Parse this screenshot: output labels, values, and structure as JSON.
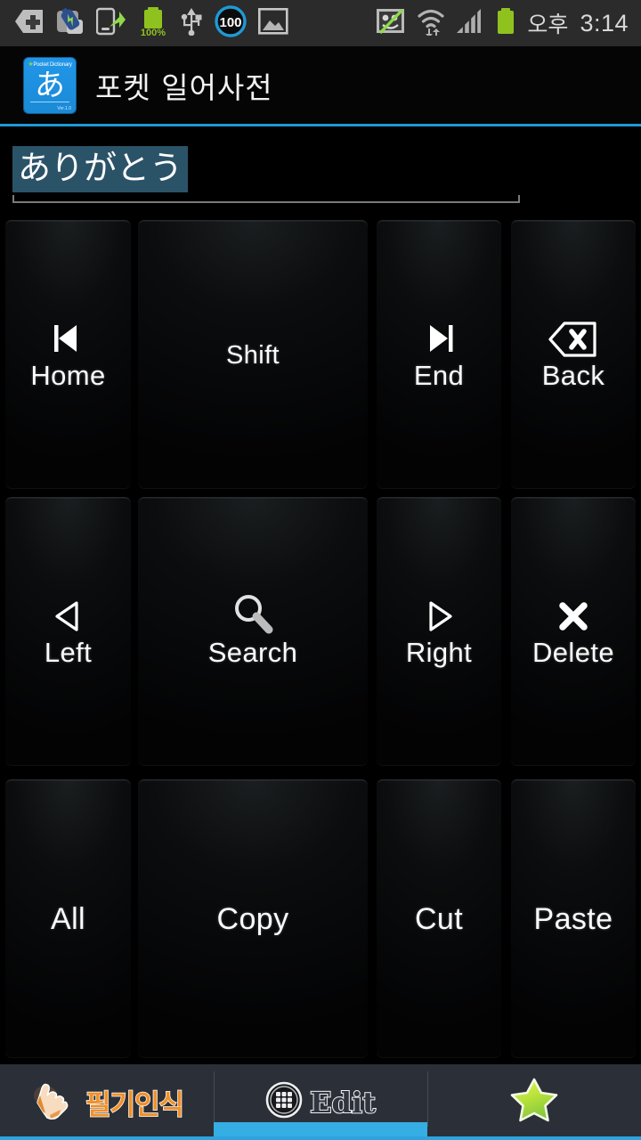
{
  "status_bar": {
    "left_icons": [
      {
        "name": "plus-badge-icon"
      },
      {
        "name": "battery-app-icon"
      },
      {
        "name": "phone-transfer-icon"
      },
      {
        "name": "battery-full-icon",
        "label": "100%"
      },
      {
        "name": "usb-icon"
      },
      {
        "name": "circle-100-icon",
        "label": "100"
      },
      {
        "name": "gallery-image-icon"
      }
    ],
    "right_icons": [
      {
        "name": "app-disabled-icon"
      },
      {
        "name": "wifi-transfer-icon"
      },
      {
        "name": "signal-bars-icon"
      },
      {
        "name": "battery-icon"
      }
    ],
    "ampm": "오후",
    "time": "3:14",
    "battery_percent": "100%",
    "data_badge": "100"
  },
  "title_bar": {
    "app_title": "포켓 일어사전",
    "logo": {
      "name": "pocket-dictionary-logo",
      "top_text": "Pocket Dictionary",
      "character": "あ",
      "sub_text": "Ver.1.0"
    },
    "accent_color": "#1e9ad6"
  },
  "search": {
    "value": "ありがとう",
    "placeholder": "",
    "clear_icon": "clear-x-icon",
    "search_icon": "search-magnifier-icon"
  },
  "keys": [
    {
      "id": "home",
      "label": "Home",
      "icon": "skip-previous-icon",
      "col": 0,
      "row": 0
    },
    {
      "id": "shift",
      "label": "Shift",
      "icon": "",
      "col": 1,
      "row": 0
    },
    {
      "id": "end",
      "label": "End",
      "icon": "skip-next-icon",
      "col": 2,
      "row": 0
    },
    {
      "id": "back",
      "label": "Back",
      "icon": "backspace-icon",
      "col": 3,
      "row": 0
    },
    {
      "id": "left",
      "label": "Left",
      "icon": "triangle-left-icon",
      "col": 0,
      "row": 1
    },
    {
      "id": "search",
      "label": "Search",
      "icon": "magnifier-icon",
      "col": 1,
      "row": 1
    },
    {
      "id": "right",
      "label": "Right",
      "icon": "triangle-right-icon",
      "col": 2,
      "row": 1
    },
    {
      "id": "delete",
      "label": "Delete",
      "icon": "cross-x-icon",
      "col": 3,
      "row": 1
    },
    {
      "id": "all",
      "label": "All",
      "icon": "",
      "col": 0,
      "row": 2
    },
    {
      "id": "copy",
      "label": "Copy",
      "icon": "",
      "col": 1,
      "row": 2
    },
    {
      "id": "cut",
      "label": "Cut",
      "icon": "",
      "col": 2,
      "row": 2
    },
    {
      "id": "paste",
      "label": "Paste",
      "icon": "",
      "col": 3,
      "row": 2
    }
  ],
  "tabs": [
    {
      "id": "handwriting",
      "label": "필기인식",
      "icon": "hand-write-icon",
      "active": false
    },
    {
      "id": "edit",
      "label": "Edit",
      "icon": "keypad-grid-icon",
      "active": true
    },
    {
      "id": "favorites",
      "label": "",
      "icon": "star-icon",
      "active": false
    }
  ],
  "colors": {
    "accent_blue": "#2ea3dd",
    "active_tab_blue": "#35aee3",
    "selection_teal": "#2b5368",
    "orange_label": "#f0902a",
    "statusbar_bg": "#2b2b2b",
    "tabbar_bg": "#2b3038"
  }
}
